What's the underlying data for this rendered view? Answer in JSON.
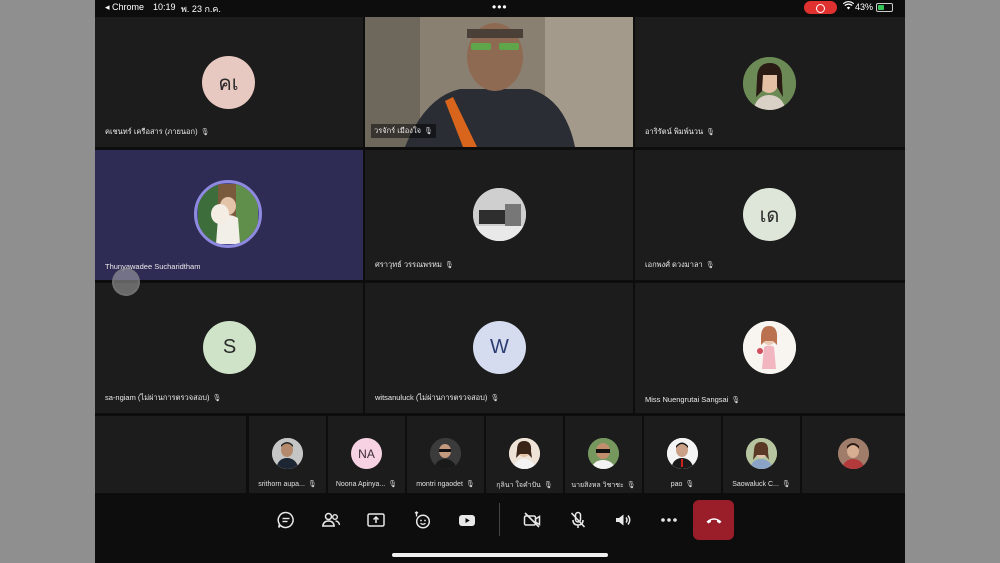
{
  "status_bar": {
    "back_label": "◂ Chrome",
    "time": "10:19",
    "date": "พ. 23 ก.ค.",
    "battery_text": "43%",
    "battery_level": 0.43
  },
  "tiles": [
    {
      "name": "คเชนทร์ เครือสาร (ภายนอก)",
      "initials": "คเ",
      "avatar_color": "#e8c9c2"
    },
    {
      "name": "วรจักร์  เมืองใจ"
    },
    {
      "name": "อาริรัตน์ พิมพ์นวน"
    },
    {
      "name": "Thunyawadee Sucharidtham"
    },
    {
      "name": "ศราวุทธ์  วรรณพรหม"
    },
    {
      "name": "เอกพงศ์ ดวงมาลา",
      "initials": "เด",
      "avatar_color": "#dde6d9"
    },
    {
      "name": "sa-ngiam (ไม่ผ่านการตรวจสอบ)",
      "initials": "S",
      "avatar_color": "#cfe3c9"
    },
    {
      "name": "witsanuluck (ไม่ผ่านการตรวจสอบ)",
      "initials": "W",
      "avatar_color": "#d5dcef"
    },
    {
      "name": "Miss Nuengrutai  Sangsai"
    }
  ],
  "strip": [
    {
      "name": "srithorn aupa...",
      "initials": ""
    },
    {
      "name": "Noona Apinya...",
      "initials": "NA"
    },
    {
      "name": "montri  ngaodet",
      "initials": ""
    },
    {
      "name": "กุลินา  ใจคำปัน",
      "initials": ""
    },
    {
      "name": "นายสิงหล  วิชาชะ",
      "initials": ""
    },
    {
      "name": "pao",
      "initials": ""
    },
    {
      "name": "Saowaluck  C...",
      "initials": ""
    },
    {
      "name": "",
      "initials": ""
    }
  ],
  "toolbar": [
    "chat-icon",
    "people-icon",
    "share-screen-icon",
    "reactions-icon",
    "youtube-icon",
    "camera-off-icon",
    "mic-off-icon",
    "speaker-icon",
    "more-icon",
    "leave-call-icon"
  ]
}
